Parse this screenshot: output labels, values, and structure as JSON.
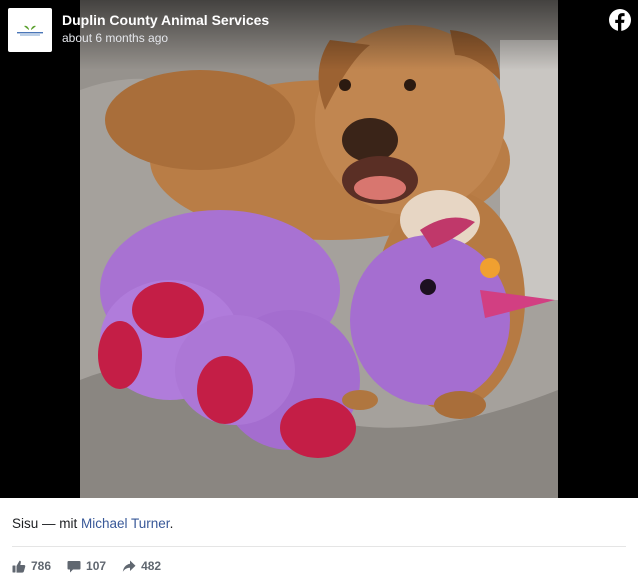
{
  "header": {
    "page_name": "Duplin County Animal Services",
    "timestamp": "about 6 months ago",
    "avatar_logo_text": "DUPLIN COUNTY"
  },
  "icons": {
    "platform": "facebook-icon",
    "like": "thumbs-up-icon",
    "comment": "comment-bubble-icon",
    "share": "share-arrow-icon"
  },
  "caption": {
    "text": "Sisu",
    "separator": " — mit ",
    "tagged_person": "Michael Turner",
    "end": "."
  },
  "stats": {
    "likes": "786",
    "comments": "107",
    "shares": "482"
  },
  "colors": {
    "brand_blue": "#1877f2",
    "link": "#385898",
    "stat_text": "#606770"
  }
}
